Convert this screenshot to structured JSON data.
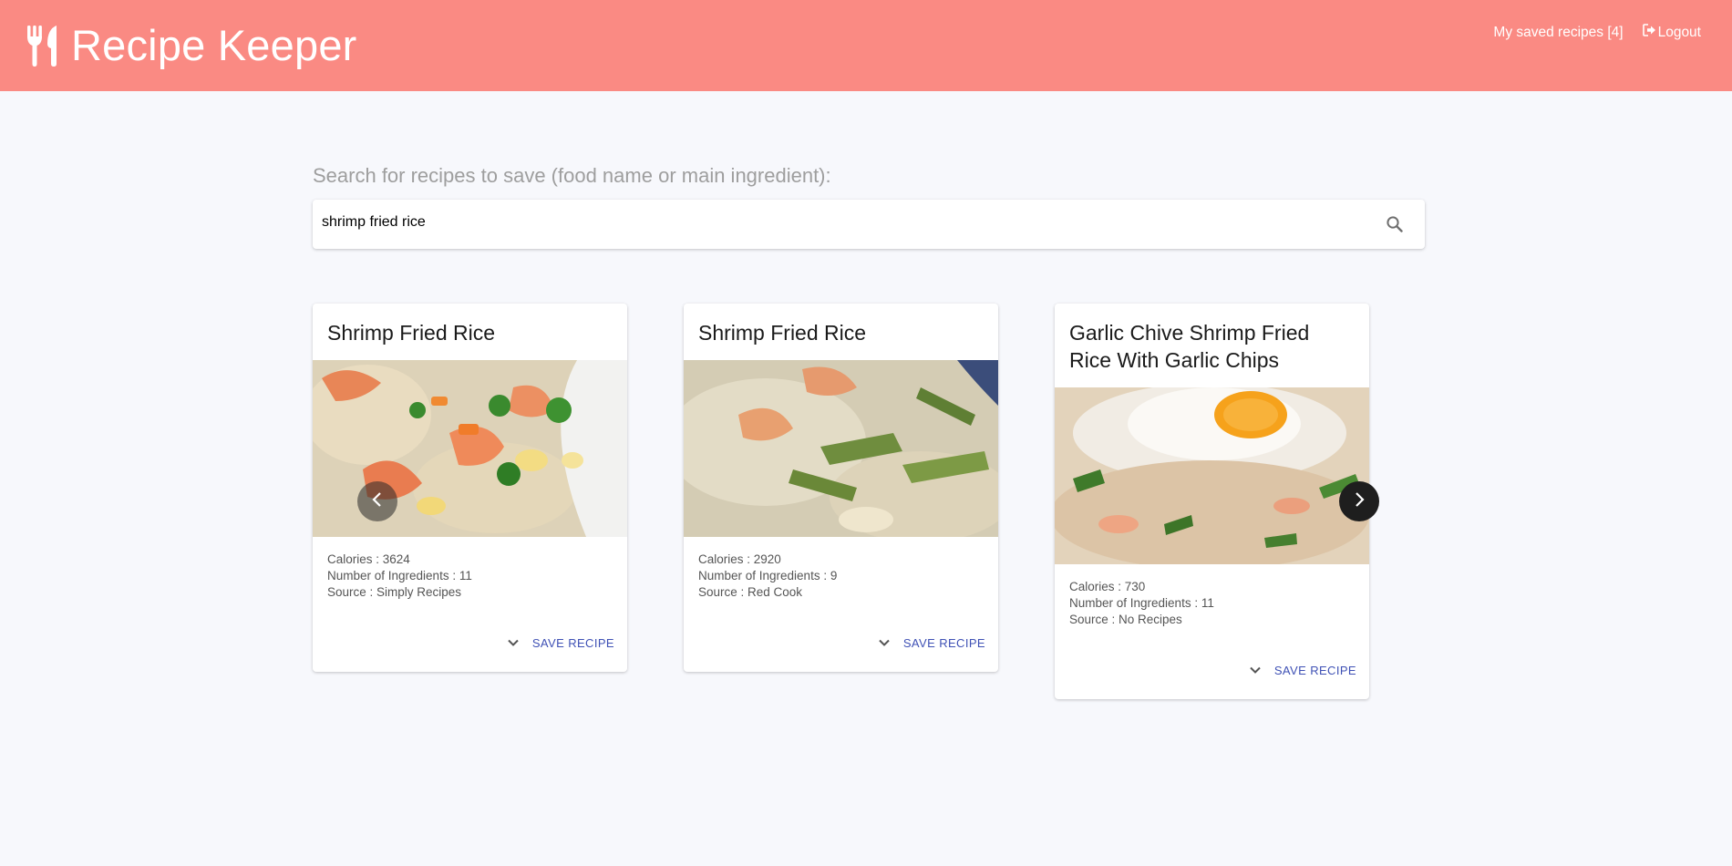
{
  "app": {
    "title": "Recipe Keeper",
    "saved_link": "My saved recipes [4]",
    "logout_label": "Logout"
  },
  "search": {
    "label": "Search for recipes to save (food name or main ingredient):",
    "value": "shrimp fried rice",
    "placeholder": ""
  },
  "cards": [
    {
      "title": "Shrimp Fried Rice",
      "calories": "Calories : 3624",
      "ingredients": "Number of Ingredients : 11",
      "source": "Source : Simply Recipes",
      "save_label": "SAVE RECIPE"
    },
    {
      "title": "Shrimp Fried Rice",
      "calories": "Calories : 2920",
      "ingredients": "Number of Ingredients : 9",
      "source": "Source : Red Cook",
      "save_label": "SAVE RECIPE"
    },
    {
      "title": "Garlic Chive Shrimp Fried Rice With Garlic Chips",
      "calories": "Calories : 730",
      "ingredients": "Number of Ingredients : 11",
      "source": "Source : No Recipes",
      "save_label": "SAVE RECIPE"
    }
  ],
  "icons": {
    "logo": "utensils-icon",
    "logout": "sign-out-icon",
    "search": "search-icon",
    "expand": "chevron-down-icon",
    "prev": "chevron-left-icon",
    "next": "chevron-right-icon"
  },
  "colors": {
    "header": "#fa8a83",
    "background": "#f7f8fc",
    "accent": "#3f51b5"
  }
}
